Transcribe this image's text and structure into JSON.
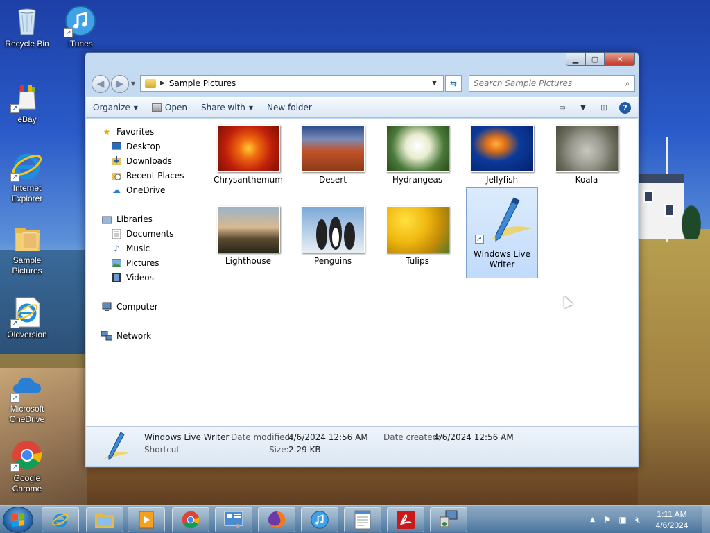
{
  "desktop": {
    "icons": [
      {
        "label": "Recycle Bin",
        "icon": "recycle-bin-icon"
      },
      {
        "label": "iTunes",
        "icon": "itunes-icon"
      },
      {
        "label": "eBay",
        "icon": "ebay-icon"
      },
      {
        "label": "Internet Explorer",
        "icon": "internet-explorer-icon"
      },
      {
        "label": "Sample Pictures",
        "icon": "folder-icon"
      },
      {
        "label": "Oldversion",
        "icon": "internet-explorer-icon"
      },
      {
        "label": "Microsoft OneDrive",
        "icon": "onedrive-icon"
      },
      {
        "label": "Google Chrome",
        "icon": "chrome-icon"
      }
    ]
  },
  "window": {
    "address": {
      "path": "Sample Pictures"
    },
    "search": {
      "placeholder": "Search Sample Pictures"
    },
    "toolbar": {
      "organize": "Organize",
      "open": "Open",
      "share_with": "Share with",
      "new_folder": "New folder"
    },
    "nav": {
      "favorites": "Favorites",
      "desktop": "Desktop",
      "downloads": "Downloads",
      "recent_places": "Recent Places",
      "onedrive": "OneDrive",
      "libraries": "Libraries",
      "documents": "Documents",
      "music": "Music",
      "pictures": "Pictures",
      "videos": "Videos",
      "computer": "Computer",
      "network": "Network"
    },
    "files": [
      {
        "name": "Chrysanthemum",
        "thumb": "chrysanthemum-thumbnail"
      },
      {
        "name": "Desert",
        "thumb": "desert-thumbnail"
      },
      {
        "name": "Hydrangeas",
        "thumb": "hydrangeas-thumbnail"
      },
      {
        "name": "Jellyfish",
        "thumb": "jellyfish-thumbnail"
      },
      {
        "name": "Koala",
        "thumb": "koala-thumbnail"
      },
      {
        "name": "Lighthouse",
        "thumb": "lighthouse-thumbnail"
      },
      {
        "name": "Penguins",
        "thumb": "penguins-thumbnail"
      },
      {
        "name": "Tulips",
        "thumb": "tulips-thumbnail"
      },
      {
        "name": "Windows Live Writer",
        "thumb": "windows-live-writer-icon",
        "selected": true
      }
    ],
    "details": {
      "name": "Windows Live Writer",
      "type": "Shortcut",
      "date_modified_label": "Date modified:",
      "date_modified": "4/6/2024 12:56 AM",
      "date_created_label": "Date created:",
      "date_created": "4/6/2024 12:56 AM",
      "size_label": "Size:",
      "size": "2.29 KB"
    }
  },
  "taskbar": {
    "pinned": [
      "internet-explorer-icon",
      "windows-explorer-icon",
      "media-player-icon",
      "chrome-icon",
      "control-panel-icon",
      "firefox-icon",
      "itunes-icon",
      "document-icon",
      "pdf-icon",
      "network-setup-icon"
    ],
    "clock": {
      "time": "1:11 AM",
      "date": "4/6/2024"
    }
  },
  "colors": {
    "accent": "#1e5aa8",
    "selection_bg": "#c1dbfc",
    "selection_border": "#7da2ce"
  }
}
